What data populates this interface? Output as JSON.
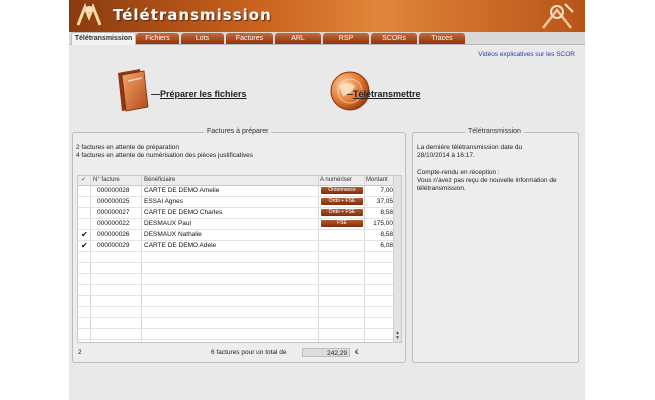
{
  "app": {
    "title": "Télétransmission"
  },
  "tabs": [
    {
      "label": "Télétransmission",
      "active": true
    },
    {
      "label": "Fichiers"
    },
    {
      "label": "Lots"
    },
    {
      "label": "Factures"
    },
    {
      "label": "ARL"
    },
    {
      "label": "RSP"
    },
    {
      "label": "SCORs"
    },
    {
      "label": "Traces"
    }
  ],
  "help_link": "Vidéos explicatives sur les SCOR",
  "actions": {
    "prepare": "Préparer les fichiers",
    "transmit": "Télétransmettre"
  },
  "invoices_panel": {
    "title": "Factures à préparer",
    "line1": "2 factures en attente de préparation",
    "line2": "4 factures en attente de numérisation des pièces justificatives",
    "columns": [
      "N° facture",
      "Bénéficiaire",
      "A numériser",
      "Montant"
    ],
    "rows": [
      {
        "checked": false,
        "number": "000000028",
        "beneficiary": "CARTE DE DEMO Amelie",
        "to_scan": "Ordonnance",
        "amount": "7,00"
      },
      {
        "checked": false,
        "number": "000000025",
        "beneficiary": "ESSAI Agnes",
        "to_scan": "Ordo + FSE",
        "amount": "37,05"
      },
      {
        "checked": false,
        "number": "000000027",
        "beneficiary": "CARTE DE DEMO Charles",
        "to_scan": "Ordo + FSE",
        "amount": "8,58"
      },
      {
        "checked": false,
        "number": "000000022",
        "beneficiary": "DESMAUX Paul",
        "to_scan": "FSE",
        "amount": "175,00"
      },
      {
        "checked": true,
        "number": "000000026",
        "beneficiary": "DESMAUX Nathalie",
        "to_scan": "",
        "amount": "8,58"
      },
      {
        "checked": true,
        "number": "000000029",
        "beneficiary": "CARTE DE DEMO Adele",
        "to_scan": "",
        "amount": "6,08"
      }
    ],
    "footer_count": "2",
    "footer_text": "6 factures pour un total de",
    "total": "242,29",
    "currency": "€"
  },
  "transmission_panel": {
    "title": "Télétransmission",
    "line1": "La dernière télétransmission date du",
    "line2": "28/10/2014 à 16:17.",
    "line3": "Compte-rendu en réception :",
    "line4": "Vous n'avez pas reçu de nouvelle information de",
    "line5": "télétransmission."
  },
  "colors": {
    "accent": "#c8611d",
    "link": "#1e3ea0"
  }
}
